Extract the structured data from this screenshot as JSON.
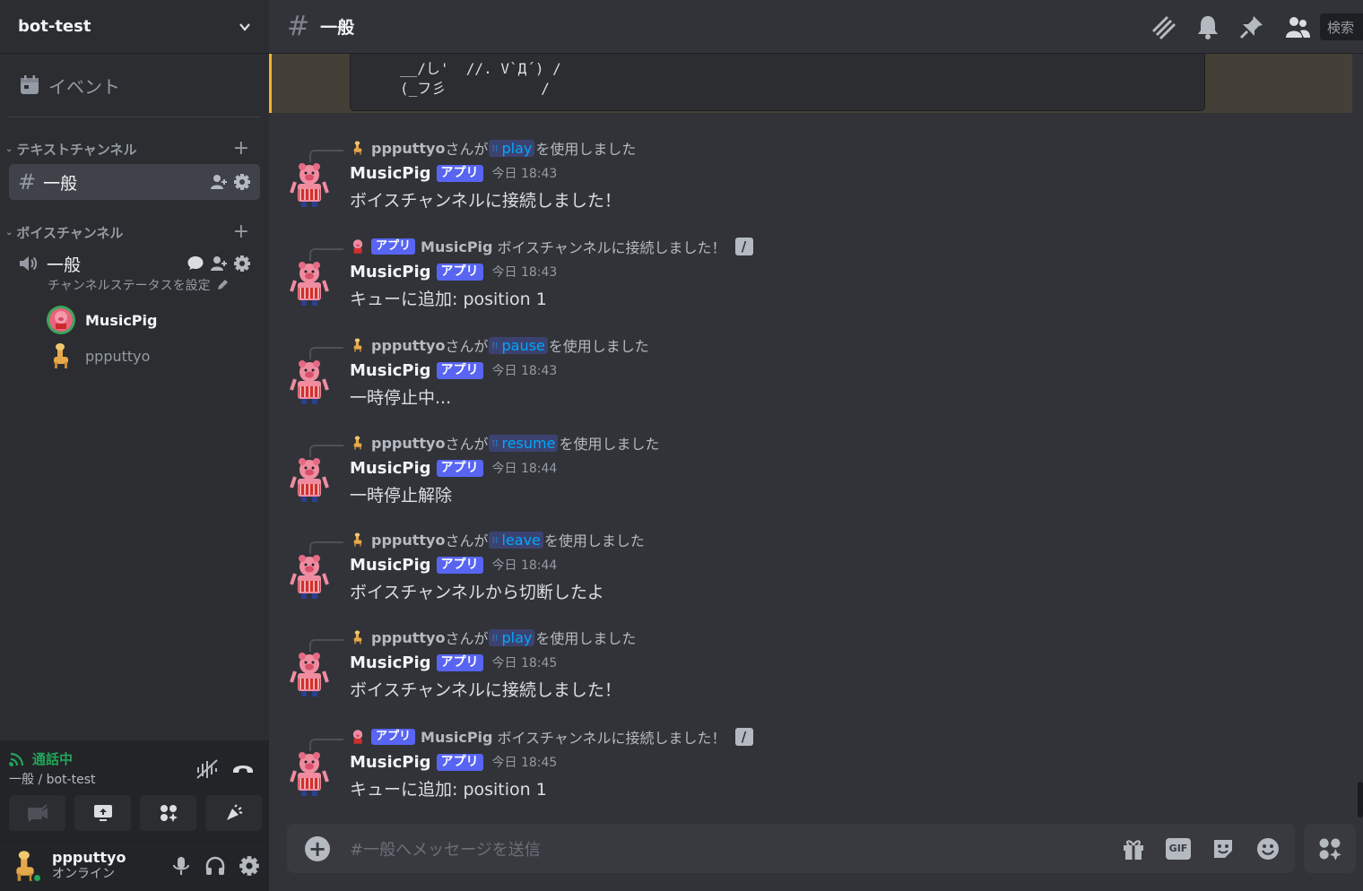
{
  "server": {
    "name": "bot-test"
  },
  "sidebar": {
    "events_label": "イベント",
    "text_category": "テキストチャンネル",
    "voice_category": "ボイスチャンネル",
    "text_channel": "一般",
    "voice_channel": "一般",
    "voice_status": "チャンネルステータスを設定",
    "voice_users": [
      {
        "name": "MusicPig"
      },
      {
        "name": "ppputtyo"
      }
    ]
  },
  "voice_panel": {
    "status": "通話中",
    "location": "一般 / bot-test"
  },
  "user_panel": {
    "name": "ppputtyo",
    "status": "オンライン"
  },
  "topbar": {
    "channel": "一般",
    "search": "検索"
  },
  "codeblock": {
    "line1": "__/し'  //. V`Д´) /",
    "line2": "(_フ彡           /"
  },
  "messages": [
    {
      "reply_user": "ppputtyo",
      "reply_pre": "さんが",
      "command": "play",
      "reply_post": "を使用しました",
      "author": "MusicPig",
      "app_tag": "アプリ",
      "time": "今日 18:43",
      "body": "ボイスチャンネルに接続しました！"
    },
    {
      "reply_app_tag": "アプリ",
      "reply_user": "MusicPig",
      "reply_text": "ボイスチャンネルに接続しました！",
      "author": "MusicPig",
      "app_tag": "アプリ",
      "time": "今日 18:43",
      "body": "キューに追加: position 1"
    },
    {
      "reply_user": "ppputtyo",
      "reply_pre": "さんが",
      "command": "pause",
      "reply_post": "を使用しました",
      "author": "MusicPig",
      "app_tag": "アプリ",
      "time": "今日 18:43",
      "body": "一時停止中..."
    },
    {
      "reply_user": "ppputtyo",
      "reply_pre": "さんが",
      "command": "resume",
      "reply_post": "を使用しました",
      "author": "MusicPig",
      "app_tag": "アプリ",
      "time": "今日 18:44",
      "body": "一時停止解除"
    },
    {
      "reply_user": "ppputtyo",
      "reply_pre": "さんが",
      "command": "leave",
      "reply_post": "を使用しました",
      "author": "MusicPig",
      "app_tag": "アプリ",
      "time": "今日 18:44",
      "body": "ボイスチャンネルから切断したよ"
    },
    {
      "reply_user": "ppputtyo",
      "reply_pre": "さんが",
      "command": "play",
      "reply_post": "を使用しました",
      "author": "MusicPig",
      "app_tag": "アプリ",
      "time": "今日 18:45",
      "body": "ボイスチャンネルに接続しました！"
    },
    {
      "reply_app_tag": "アプリ",
      "reply_user": "MusicPig",
      "reply_text": "ボイスチャンネルに接続しました！",
      "author": "MusicPig",
      "app_tag": "アプリ",
      "time": "今日 18:45",
      "body": "キューに追加: position 1"
    }
  ],
  "composer": {
    "placeholder": "#一般へメッセージを送信",
    "gif_label": "GIF"
  },
  "colors": {
    "accent": "#5865f2",
    "online": "#23a55a",
    "command_text": "#00a8fc",
    "highlight_bar": "#f0b232"
  }
}
